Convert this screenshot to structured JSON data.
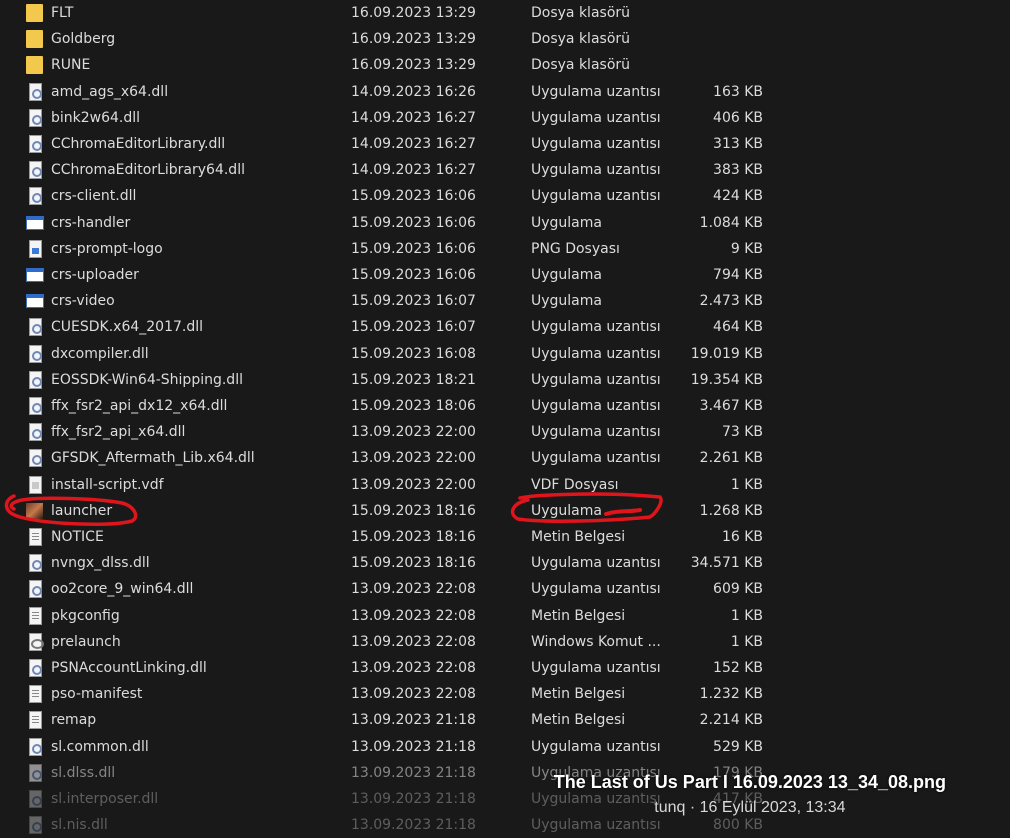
{
  "files": [
    {
      "name": "FLT",
      "date": "16.09.2023 13:29",
      "type": "Dosya klasörü",
      "size": "",
      "icon": "folder-icon"
    },
    {
      "name": "Goldberg",
      "date": "16.09.2023 13:29",
      "type": "Dosya klasörü",
      "size": "",
      "icon": "folder-icon"
    },
    {
      "name": "RUNE",
      "date": "16.09.2023 13:29",
      "type": "Dosya klasörü",
      "size": "",
      "icon": "folder-icon"
    },
    {
      "name": "amd_ags_x64.dll",
      "date": "14.09.2023 16:26",
      "type": "Uygulama uzantısı",
      "size": "163 KB",
      "icon": "dll-icon"
    },
    {
      "name": "bink2w64.dll",
      "date": "14.09.2023 16:27",
      "type": "Uygulama uzantısı",
      "size": "406 KB",
      "icon": "dll-icon"
    },
    {
      "name": "CChromaEditorLibrary.dll",
      "date": "14.09.2023 16:27",
      "type": "Uygulama uzantısı",
      "size": "313 KB",
      "icon": "dll-icon"
    },
    {
      "name": "CChromaEditorLibrary64.dll",
      "date": "14.09.2023 16:27",
      "type": "Uygulama uzantısı",
      "size": "383 KB",
      "icon": "dll-icon"
    },
    {
      "name": "crs-client.dll",
      "date": "15.09.2023 16:06",
      "type": "Uygulama uzantısı",
      "size": "424 KB",
      "icon": "dll-icon"
    },
    {
      "name": "crs-handler",
      "date": "15.09.2023 16:06",
      "type": "Uygulama",
      "size": "1.084 KB",
      "icon": "exe-icon"
    },
    {
      "name": "crs-prompt-logo",
      "date": "15.09.2023 16:06",
      "type": "PNG Dosyası",
      "size": "9 KB",
      "icon": "png-icon"
    },
    {
      "name": "crs-uploader",
      "date": "15.09.2023 16:06",
      "type": "Uygulama",
      "size": "794 KB",
      "icon": "exe-icon"
    },
    {
      "name": "crs-video",
      "date": "15.09.2023 16:07",
      "type": "Uygulama",
      "size": "2.473 KB",
      "icon": "exe-icon"
    },
    {
      "name": "CUESDK.x64_2017.dll",
      "date": "15.09.2023 16:07",
      "type": "Uygulama uzantısı",
      "size": "464 KB",
      "icon": "dll-icon"
    },
    {
      "name": "dxcompiler.dll",
      "date": "15.09.2023 16:08",
      "type": "Uygulama uzantısı",
      "size": "19.019 KB",
      "icon": "dll-icon"
    },
    {
      "name": "EOSSDK-Win64-Shipping.dll",
      "date": "15.09.2023 18:21",
      "type": "Uygulama uzantısı",
      "size": "19.354 KB",
      "icon": "dll-icon"
    },
    {
      "name": "ffx_fsr2_api_dx12_x64.dll",
      "date": "15.09.2023 18:06",
      "type": "Uygulama uzantısı",
      "size": "3.467 KB",
      "icon": "dll-icon"
    },
    {
      "name": "ffx_fsr2_api_x64.dll",
      "date": "13.09.2023 22:00",
      "type": "Uygulama uzantısı",
      "size": "73 KB",
      "icon": "dll-icon"
    },
    {
      "name": "GFSDK_Aftermath_Lib.x64.dll",
      "date": "13.09.2023 22:00",
      "type": "Uygulama uzantısı",
      "size": "2.261 KB",
      "icon": "dll-icon"
    },
    {
      "name": "install-script.vdf",
      "date": "13.09.2023 22:00",
      "type": "VDF Dosyası",
      "size": "1 KB",
      "icon": "vdf-icon"
    },
    {
      "name": "launcher",
      "date": "15.09.2023 18:16",
      "type": "Uygulama",
      "size": "1.268 KB",
      "icon": "image-icon"
    },
    {
      "name": "NOTICE",
      "date": "15.09.2023 18:16",
      "type": "Metin Belgesi",
      "size": "16 KB",
      "icon": "text-file-icon"
    },
    {
      "name": "nvngx_dlss.dll",
      "date": "15.09.2023 18:16",
      "type": "Uygulama uzantısı",
      "size": "34.571 KB",
      "icon": "dll-icon"
    },
    {
      "name": "oo2core_9_win64.dll",
      "date": "13.09.2023 22:08",
      "type": "Uygulama uzantısı",
      "size": "609 KB",
      "icon": "dll-icon"
    },
    {
      "name": "pkgconfig",
      "date": "13.09.2023 22:08",
      "type": "Metin Belgesi",
      "size": "1 KB",
      "icon": "text-file-icon"
    },
    {
      "name": "prelaunch",
      "date": "13.09.2023 22:08",
      "type": "Windows Komut ...",
      "size": "1 KB",
      "icon": "cmd-icon"
    },
    {
      "name": "PSNAccountLinking.dll",
      "date": "13.09.2023 22:08",
      "type": "Uygulama uzantısı",
      "size": "152 KB",
      "icon": "dll-icon"
    },
    {
      "name": "pso-manifest",
      "date": "13.09.2023 22:08",
      "type": "Metin Belgesi",
      "size": "1.232 KB",
      "icon": "text-file-icon"
    },
    {
      "name": "remap",
      "date": "13.09.2023 21:18",
      "type": "Metin Belgesi",
      "size": "2.214 KB",
      "icon": "text-file-icon"
    },
    {
      "name": "sl.common.dll",
      "date": "13.09.2023 21:18",
      "type": "Uygulama uzantısı",
      "size": "529 KB",
      "icon": "dll-icon"
    },
    {
      "name": "sl.dlss.dll",
      "date": "13.09.2023 21:18",
      "type": "Uygulama uzantısı",
      "size": "179 KB",
      "icon": "dll-icon"
    },
    {
      "name": "sl.interposer.dll",
      "date": "13.09.2023 21:18",
      "type": "Uygulama uzantısı",
      "size": "417 KB",
      "icon": "dll-icon"
    },
    {
      "name": "sl.nis.dll",
      "date": "13.09.2023 21:18",
      "type": "Uygulama uzantısı",
      "size": "800 KB",
      "icon": "dll-icon"
    }
  ],
  "caption": {
    "title": "The Last of Us Part I 16.09.2023 13_34_08.png",
    "subtitle": "tunq · 16 Eylül 2023, 13:34"
  },
  "colors": {
    "background": "#191919",
    "text": "#dcdcdc",
    "annotation": "#e0141b",
    "folder": "#f2c94c"
  }
}
